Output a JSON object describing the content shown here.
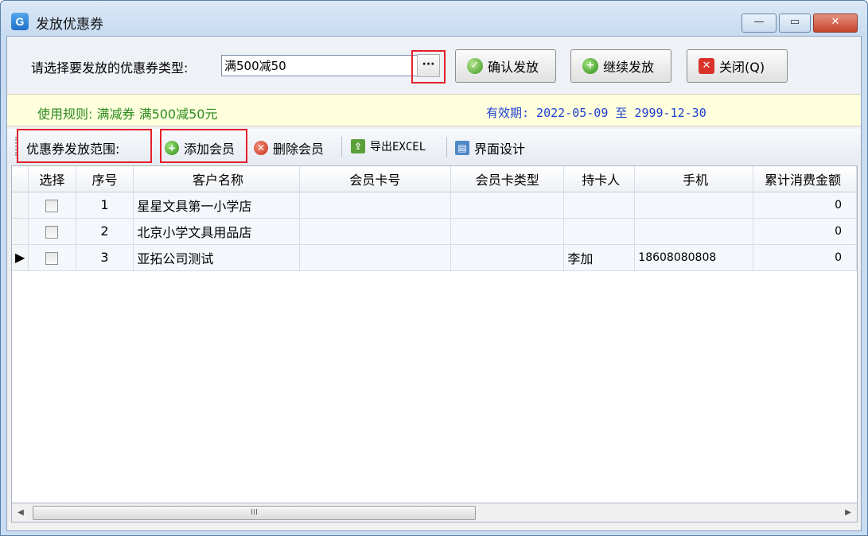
{
  "window": {
    "title": "发放优惠券",
    "app_icon_glyph": "G",
    "min_glyph": "—",
    "max_glyph": "▭",
    "close_glyph": "✕"
  },
  "selector": {
    "label": "请选择要发放的优惠券类型:",
    "value": "满500减50",
    "ellipsis": "···"
  },
  "buttons": {
    "confirm": "确认发放",
    "continue": "继续发放",
    "close": "关闭(Q)"
  },
  "rules": {
    "rule": "使用规则: 满减券 满500减50元",
    "validity": "有效期: 2022-05-09 至 2999-12-30"
  },
  "toolbar": {
    "scope_label": "优惠券发放范围:",
    "add_member": "添加会员",
    "delete_member": "删除会员",
    "export_excel": "导出EXCEL",
    "layout_design": "界面设计"
  },
  "table": {
    "columns": [
      "选择",
      "序号",
      "客户名称",
      "会员卡号",
      "会员卡类型",
      "持卡人",
      "手机",
      "累计消费金额"
    ],
    "rows": [
      {
        "no": "1",
        "name": "星星文具第一小学店",
        "card": "",
        "type": "",
        "holder": "",
        "phone": "",
        "amount": "0",
        "current": ""
      },
      {
        "no": "2",
        "name": "北京小学文具用品店",
        "card": "",
        "type": "",
        "holder": "",
        "phone": "",
        "amount": "0",
        "current": ""
      },
      {
        "no": "3",
        "name": "亚拓公司测试",
        "card": "",
        "type": "",
        "holder": "李加",
        "phone": "18608080808",
        "amount": "0",
        "current": "▶"
      }
    ]
  },
  "scrollbar": {
    "left_arrow": "◀",
    "right_arrow": "▶",
    "grip": "III"
  },
  "colors": {
    "rule_text": "#2a8a1c",
    "validity_text": "#1f3fd0",
    "highlight_box": "#e3202a"
  },
  "icons": {
    "confirm": "check-circle-icon",
    "continue": "plus-circle-icon",
    "close": "close-square-icon",
    "add_member": "plus-circle-icon",
    "delete_member": "x-circle-icon",
    "export_excel": "excel-export-icon",
    "layout_design": "layout-icon"
  }
}
